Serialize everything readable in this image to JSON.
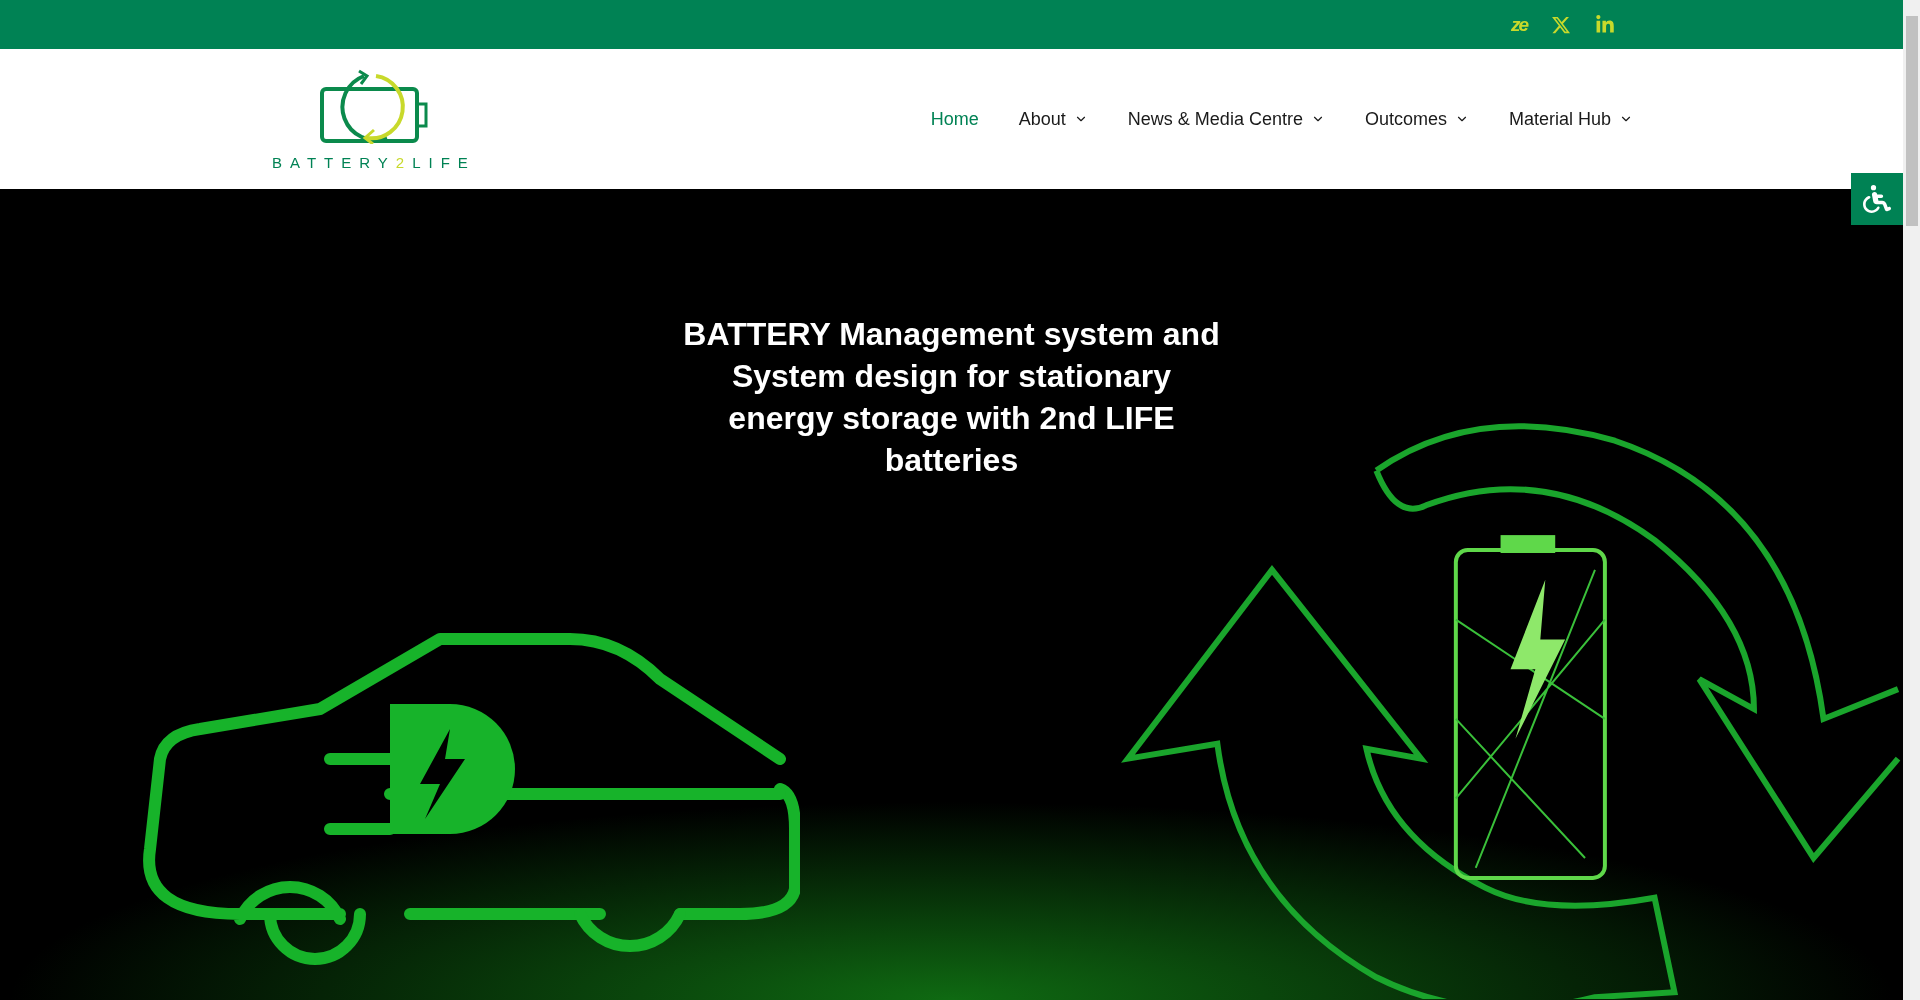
{
  "top_bar": {
    "social_links": [
      {
        "kind": "zenodo",
        "label": "ze"
      },
      {
        "kind": "x"
      },
      {
        "kind": "linkedin"
      }
    ]
  },
  "header": {
    "logo": {
      "parts": [
        {
          "text": "BATTERY",
          "color": "#008254"
        },
        {
          "text": "2",
          "color": "#c8d92b"
        },
        {
          "text": "LIFE",
          "color": "#008254"
        }
      ]
    },
    "nav": [
      {
        "label": "Home",
        "selected": true,
        "dropdown": false
      },
      {
        "label": "About",
        "selected": false,
        "dropdown": true
      },
      {
        "label": "News & Media Centre",
        "selected": false,
        "dropdown": true
      },
      {
        "label": "Outcomes",
        "selected": false,
        "dropdown": true
      },
      {
        "label": "Material Hub",
        "selected": false,
        "dropdown": true
      }
    ]
  },
  "hero": {
    "title": "BATTERY Management system and System design for stationary energy storage with 2nd LIFE batteries"
  }
}
